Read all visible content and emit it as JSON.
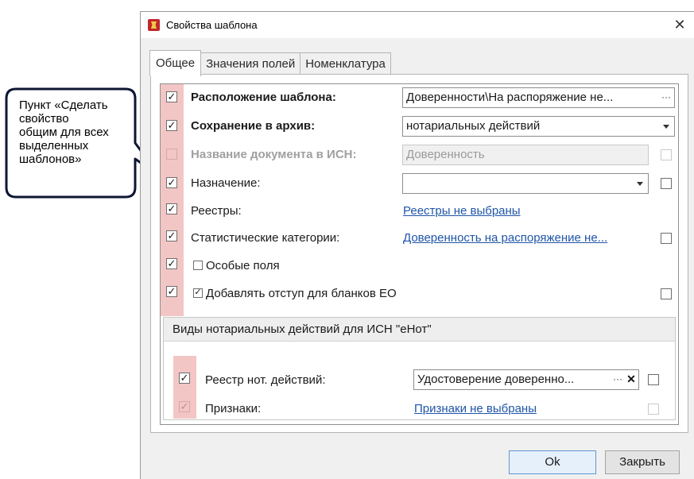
{
  "callout": {
    "text": "Пункт «Сделать\nсвойство\nобщим для всех\nвыделенных\nшаблонов»"
  },
  "window": {
    "title": "Свойства шаблона",
    "close_glyph": "✕"
  },
  "tabs": [
    {
      "label": "Общее",
      "active": true
    },
    {
      "label": "Значения полей",
      "active": false
    },
    {
      "label": "Номенклатура",
      "active": false
    }
  ],
  "rows": {
    "location": {
      "label": "Расположение  шаблона:",
      "value": "Доверенности\\На распоряжение не...",
      "btn": "···"
    },
    "archive": {
      "label": "Сохранение в архив:",
      "value": "нотариальных действий"
    },
    "isn_name": {
      "label": "Название документа в ИСН:",
      "value": "Доверенность"
    },
    "purpose": {
      "label": "Назначение:",
      "value": ""
    },
    "registries": {
      "label": "Реестры:",
      "link": "Реестры не выбраны"
    },
    "stat_categories": {
      "label": "Статистические категории:",
      "link": "Доверенность на распоряжение не..."
    },
    "special_fields": {
      "label": "Особые поля"
    },
    "indent": {
      "label": "Добавлять отступ для бланков ЕО"
    }
  },
  "group": {
    "title": "Виды нотариальных действий для ИСН \"еНот\"",
    "registry": {
      "label": "Реестр нот. действий:",
      "value": "Удостоверение доверенно...",
      "dots": "···",
      "clear": "✕"
    },
    "signs": {
      "label": "Признаки:",
      "link": "Признаки не выбраны"
    }
  },
  "buttons": {
    "ok": "Ok",
    "close": "Закрыть"
  },
  "check_glyph": "✓"
}
